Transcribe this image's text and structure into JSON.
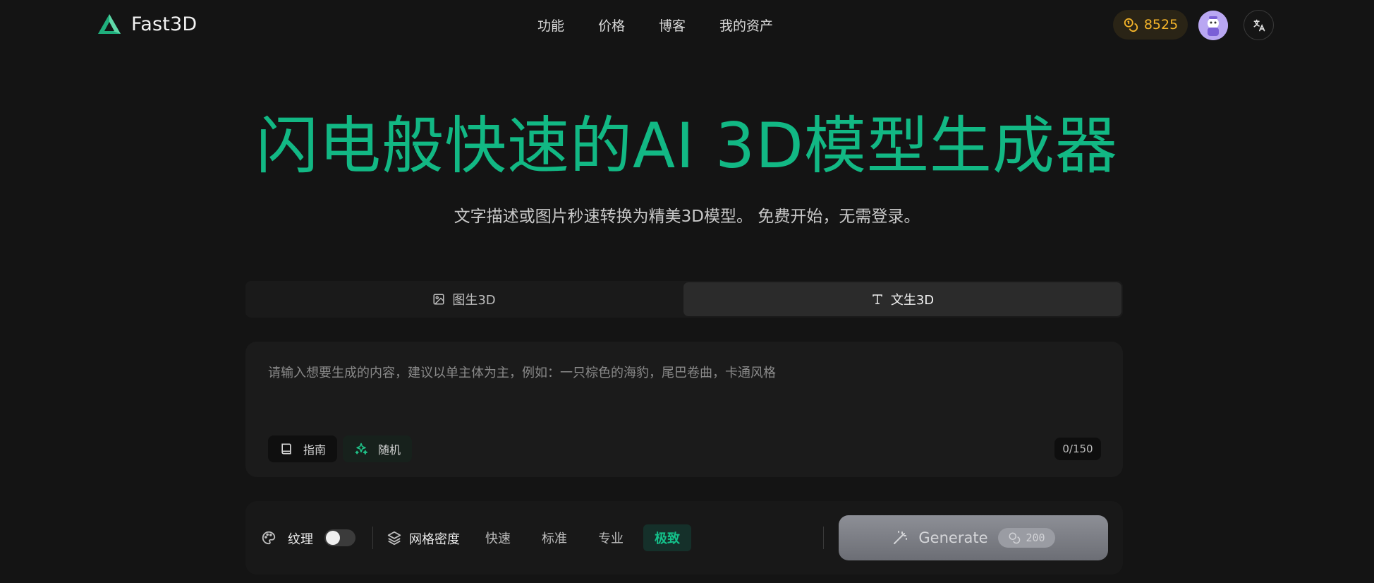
{
  "header": {
    "brand": "Fast3D",
    "nav": [
      "功能",
      "价格",
      "博客",
      "我的资产"
    ],
    "credits": "8525"
  },
  "hero": {
    "title": "闪电般快速的AI 3D模型生成器",
    "subtitle": "文字描述或图片秒速转换为精美3D模型。 免费开始，无需登录。"
  },
  "tabs": {
    "image": "图生3D",
    "text": "文生3D",
    "active": "text"
  },
  "prompt": {
    "placeholder": "请输入想要生成的内容，建议以单主体为主，例如：一只棕色的海豹，尾巴卷曲，卡通风格",
    "value": "",
    "guide_label": "指南",
    "random_label": "随机",
    "counter": "0/150"
  },
  "options": {
    "texture_label": "纹理",
    "texture_on": false,
    "mesh_label": "网格密度",
    "density_options": [
      "快速",
      "标准",
      "专业",
      "极致"
    ],
    "density_selected": "极致"
  },
  "generate": {
    "label": "Generate",
    "cost": "200"
  },
  "colors": {
    "accent": "#12b884",
    "credits": "#f5b52a",
    "background": "#141414"
  }
}
